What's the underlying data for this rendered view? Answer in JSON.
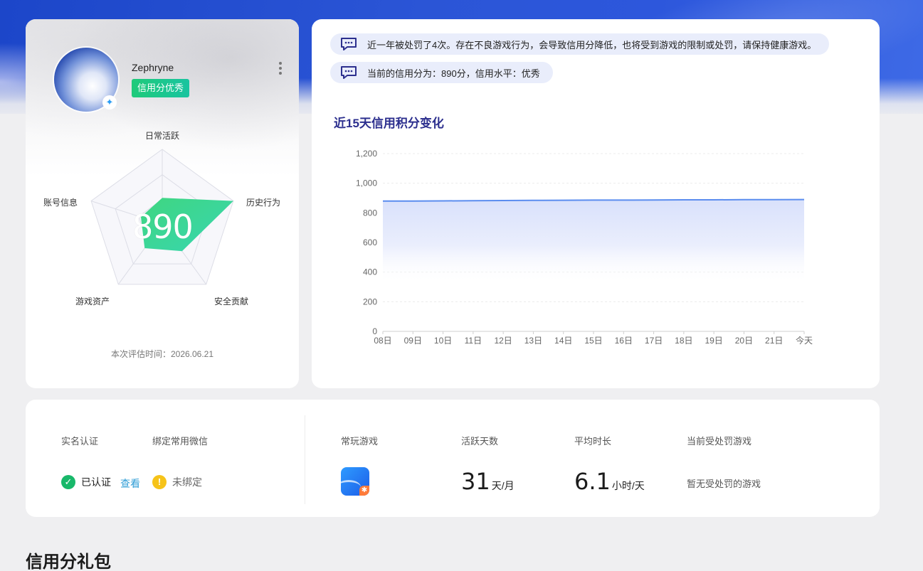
{
  "profile": {
    "username": "Zephryne",
    "credit_tag": "信用分优秀",
    "score": "890",
    "radar_labels": {
      "top": "日常活跃",
      "right": "历史行为",
      "bottom_right": "安全贡献",
      "bottom_left": "游戏资产",
      "left": "账号信息"
    },
    "radar_values": [
      0.35,
      1.0,
      0.45,
      0.4,
      0.3
    ],
    "eval_time": "本次评估时间：2026.06.21"
  },
  "notices": [
    "近一年被处罚了4次。存在不良游戏行为，会导致信用分降低，也将受到游戏的限制或处罚，请保持健康游戏。",
    "当前的信用分为：890分，信用水平：优秀"
  ],
  "chart_title": "近15天信用积分变化",
  "chart_data": {
    "type": "area",
    "title": "近15天信用积分变化",
    "x": [
      "08日",
      "09日",
      "10日",
      "11日",
      "12日",
      "13日",
      "14日",
      "15日",
      "16日",
      "17日",
      "18日",
      "19日",
      "20日",
      "21日",
      "今天"
    ],
    "values": [
      880,
      880,
      881,
      882,
      883,
      884,
      885,
      886,
      886,
      887,
      888,
      888,
      889,
      889,
      890
    ],
    "y_ticks": [
      "0",
      "200",
      "400",
      "600",
      "800",
      "1,000",
      "1,200"
    ],
    "ylim": [
      0,
      1200
    ],
    "grid": true,
    "color": "#5b8def"
  },
  "stats": {
    "realname_label": "实名认证",
    "wechat_label": "绑定常用微信",
    "realname_status": "已认证",
    "view_link": "查看",
    "wechat_status": "未绑定",
    "game_label": "常玩游戏",
    "active_label": "活跃天数",
    "active_value": "31",
    "active_unit": "天/月",
    "avg_label": "平均时长",
    "avg_value": "6.1",
    "avg_unit": "小时/天",
    "punish_label": "当前受处罚游戏",
    "punish_value": "暂无受处罚的游戏"
  },
  "gift_section_title": "信用分礼包"
}
